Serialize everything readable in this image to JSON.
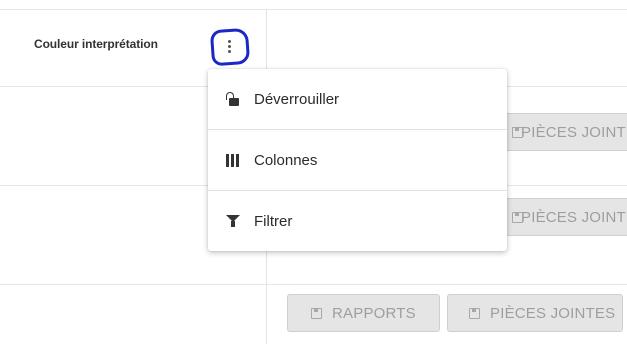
{
  "grid": {
    "column_header": "Couleur interprétation",
    "column_menu_button": "more-vert-icon"
  },
  "rows": [
    {
      "buttons": [
        {
          "label": "PIÈCES JOINTES",
          "icon": "save-icon"
        }
      ]
    },
    {
      "buttons": [
        {
          "label": "PIÈCES JOINTES",
          "icon": "save-icon"
        }
      ]
    },
    {
      "buttons": [
        {
          "label": "RAPPORTS",
          "icon": "save-icon"
        },
        {
          "label": "PIÈCES JOINTES",
          "icon": "save-icon"
        }
      ]
    }
  ],
  "column_menu": {
    "items": [
      {
        "label": "Déverrouiller",
        "icon": "unlock-icon"
      },
      {
        "label": "Colonnes",
        "icon": "columns-icon"
      },
      {
        "label": "Filtrer",
        "icon": "filter-icon"
      }
    ]
  },
  "colors": {
    "annotation_circle": "#1b27c7",
    "disabled_button_bg": "#e5e5e5",
    "disabled_button_text": "#9e9e9e"
  }
}
